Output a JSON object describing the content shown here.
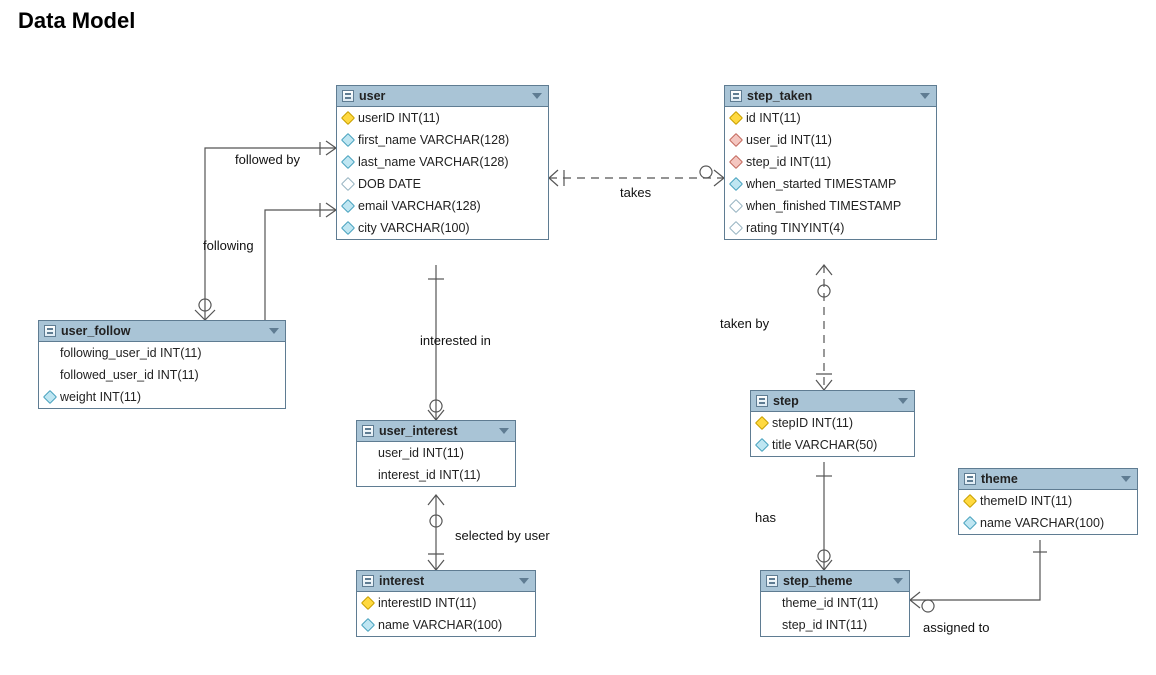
{
  "title": "Data Model",
  "tables": {
    "user": {
      "name": "user",
      "cols": [
        {
          "icon": "key",
          "text": "userID INT(11)"
        },
        {
          "icon": "blue",
          "text": "first_name VARCHAR(128)"
        },
        {
          "icon": "blue",
          "text": "last_name VARCHAR(128)"
        },
        {
          "icon": "open",
          "text": "DOB DATE"
        },
        {
          "icon": "blue",
          "text": "email VARCHAR(128)"
        },
        {
          "icon": "blue",
          "text": "city VARCHAR(100)"
        }
      ]
    },
    "step_taken": {
      "name": "step_taken",
      "cols": [
        {
          "icon": "key",
          "text": "id INT(11)"
        },
        {
          "icon": "red",
          "text": "user_id INT(11)"
        },
        {
          "icon": "red",
          "text": "step_id INT(11)"
        },
        {
          "icon": "blue",
          "text": "when_started TIMESTAMP"
        },
        {
          "icon": "open",
          "text": "when_finished TIMESTAMP"
        },
        {
          "icon": "open",
          "text": "rating TINYINT(4)"
        }
      ]
    },
    "user_follow": {
      "name": "user_follow",
      "cols": [
        {
          "icon": "none",
          "text": "following_user_id INT(11)"
        },
        {
          "icon": "none",
          "text": "followed_user_id INT(11)"
        },
        {
          "icon": "blue",
          "text": "weight INT(11)"
        }
      ]
    },
    "user_interest": {
      "name": "user_interest",
      "cols": [
        {
          "icon": "none",
          "text": "user_id INT(11)"
        },
        {
          "icon": "none",
          "text": "interest_id INT(11)"
        }
      ]
    },
    "interest": {
      "name": "interest",
      "cols": [
        {
          "icon": "key",
          "text": "interestID INT(11)"
        },
        {
          "icon": "blue",
          "text": "name VARCHAR(100)"
        }
      ]
    },
    "step": {
      "name": "step",
      "cols": [
        {
          "icon": "key",
          "text": "stepID INT(11)"
        },
        {
          "icon": "blue",
          "text": "title VARCHAR(50)"
        }
      ]
    },
    "step_theme": {
      "name": "step_theme",
      "cols": [
        {
          "icon": "none",
          "text": "theme_id INT(11)"
        },
        {
          "icon": "none",
          "text": "step_id INT(11)"
        }
      ]
    },
    "theme": {
      "name": "theme",
      "cols": [
        {
          "icon": "key",
          "text": "themeID INT(11)"
        },
        {
          "icon": "blue",
          "text": "name VARCHAR(100)"
        }
      ]
    }
  },
  "labels": {
    "followed_by": "followed by",
    "following": "following",
    "takes": "takes",
    "interested_in": "interested in",
    "selected_by_user": "selected by user",
    "taken_by": "taken by",
    "has": "has",
    "assigned_to": "assigned to"
  }
}
